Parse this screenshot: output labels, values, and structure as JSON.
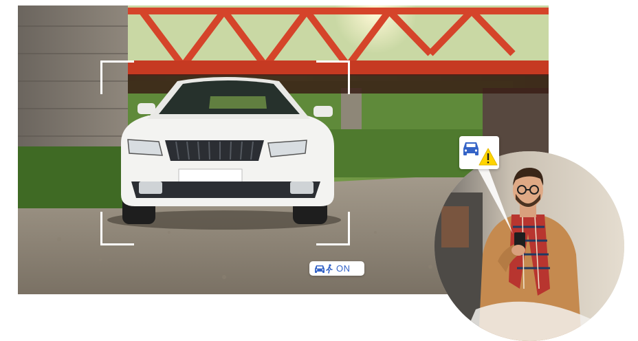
{
  "badge": {
    "icons": [
      "car-icon",
      "pedestrian-icon"
    ],
    "label": "ON",
    "label_color": "#3463c7"
  },
  "alert": {
    "icons": [
      "car-icon",
      "warning-icon"
    ],
    "warning_label": "!",
    "warning_color": "#ffd400",
    "car_color": "#3463c7"
  },
  "colors": {
    "bridge": "#d5442a",
    "bracket": "#ffffff",
    "car_body": "#f3f3f1"
  }
}
